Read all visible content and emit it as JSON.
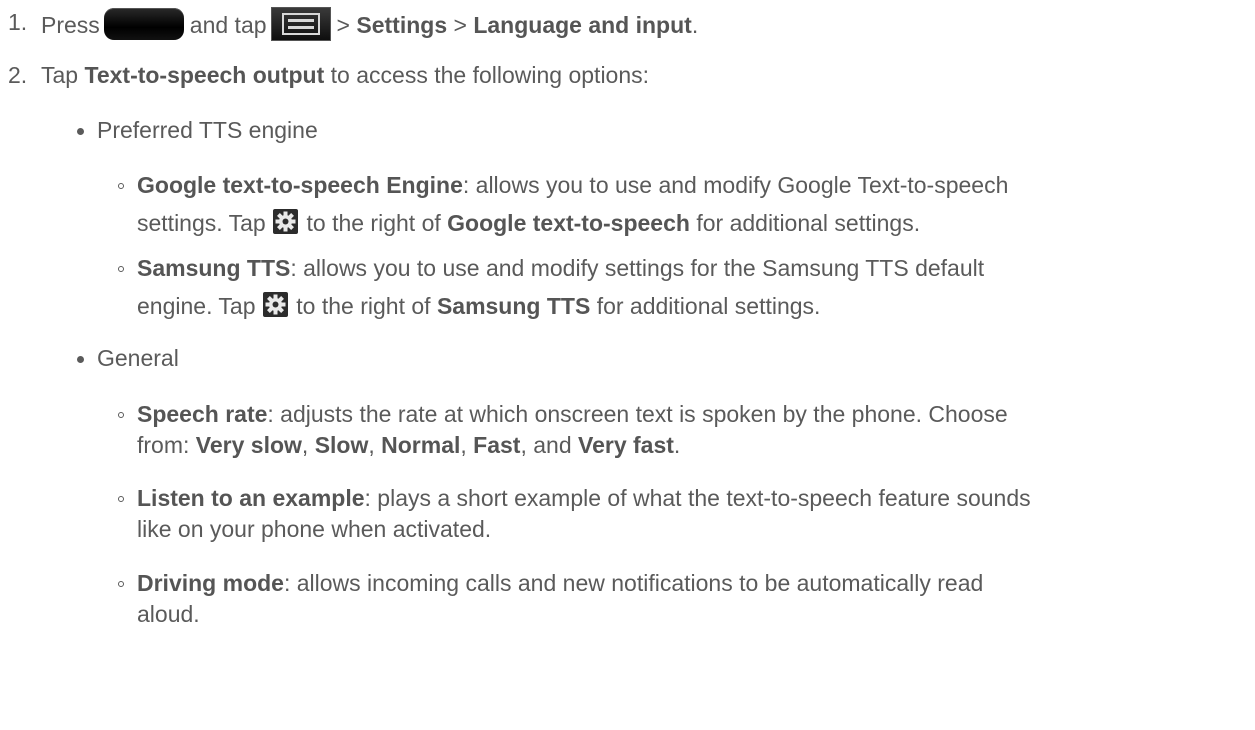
{
  "step1": {
    "number": "1.",
    "press": "Press",
    "and_tap": "and tap",
    "sep1": ">",
    "settings": "Settings",
    "sep2": ">",
    "lang": "Language and input",
    "end": "."
  },
  "step2": {
    "number": "2.",
    "tap": "Tap",
    "tts_output": "Text-to-speech output",
    "rest": "to access the following options:"
  },
  "section_preferred": {
    "title": "Preferred TTS engine",
    "google": {
      "term": "Google text-to-speech Engine",
      "desc_line1": ": allows you to use and modify Google Text-to-speech",
      "line2_a": "settings. Tap",
      "line2_b": "to the right of",
      "line2_term": "Google text-to-speech",
      "line2_c": "for additional settings."
    },
    "samsung": {
      "term": "Samsung TTS",
      "desc_line1": ": allows you to use and modify settings for the Samsung TTS default",
      "line2_a": "engine. Tap",
      "line2_b": "to the right of",
      "line2_term": "Samsung TTS",
      "line2_c": "for additional settings."
    }
  },
  "section_general": {
    "title": "General",
    "speech_rate": {
      "term": "Speech rate",
      "desc_line1": ": adjusts the rate at which onscreen text is spoken by the phone. Choose",
      "line2_a": "from:",
      "opt1": "Very slow",
      "comma1": ",",
      "opt2": "Slow",
      "comma2": ",",
      "opt3": "Normal",
      "comma3": ",",
      "opt4": "Fast",
      "and": ", and",
      "opt5": "Very fast",
      "end": "."
    },
    "listen": {
      "term": "Listen to an example",
      "desc_line1": ": plays a short example of what the text-to-speech feature sounds",
      "line2": "like on your phone when activated."
    },
    "driving": {
      "term": "Driving mode",
      "desc_line1": ": allows incoming calls and new notifications to be automatically read",
      "line2": "aloud."
    }
  },
  "icons": {
    "home_key": "home-key-icon",
    "menu_key": "menu-key-icon",
    "gear": "gear-icon"
  }
}
